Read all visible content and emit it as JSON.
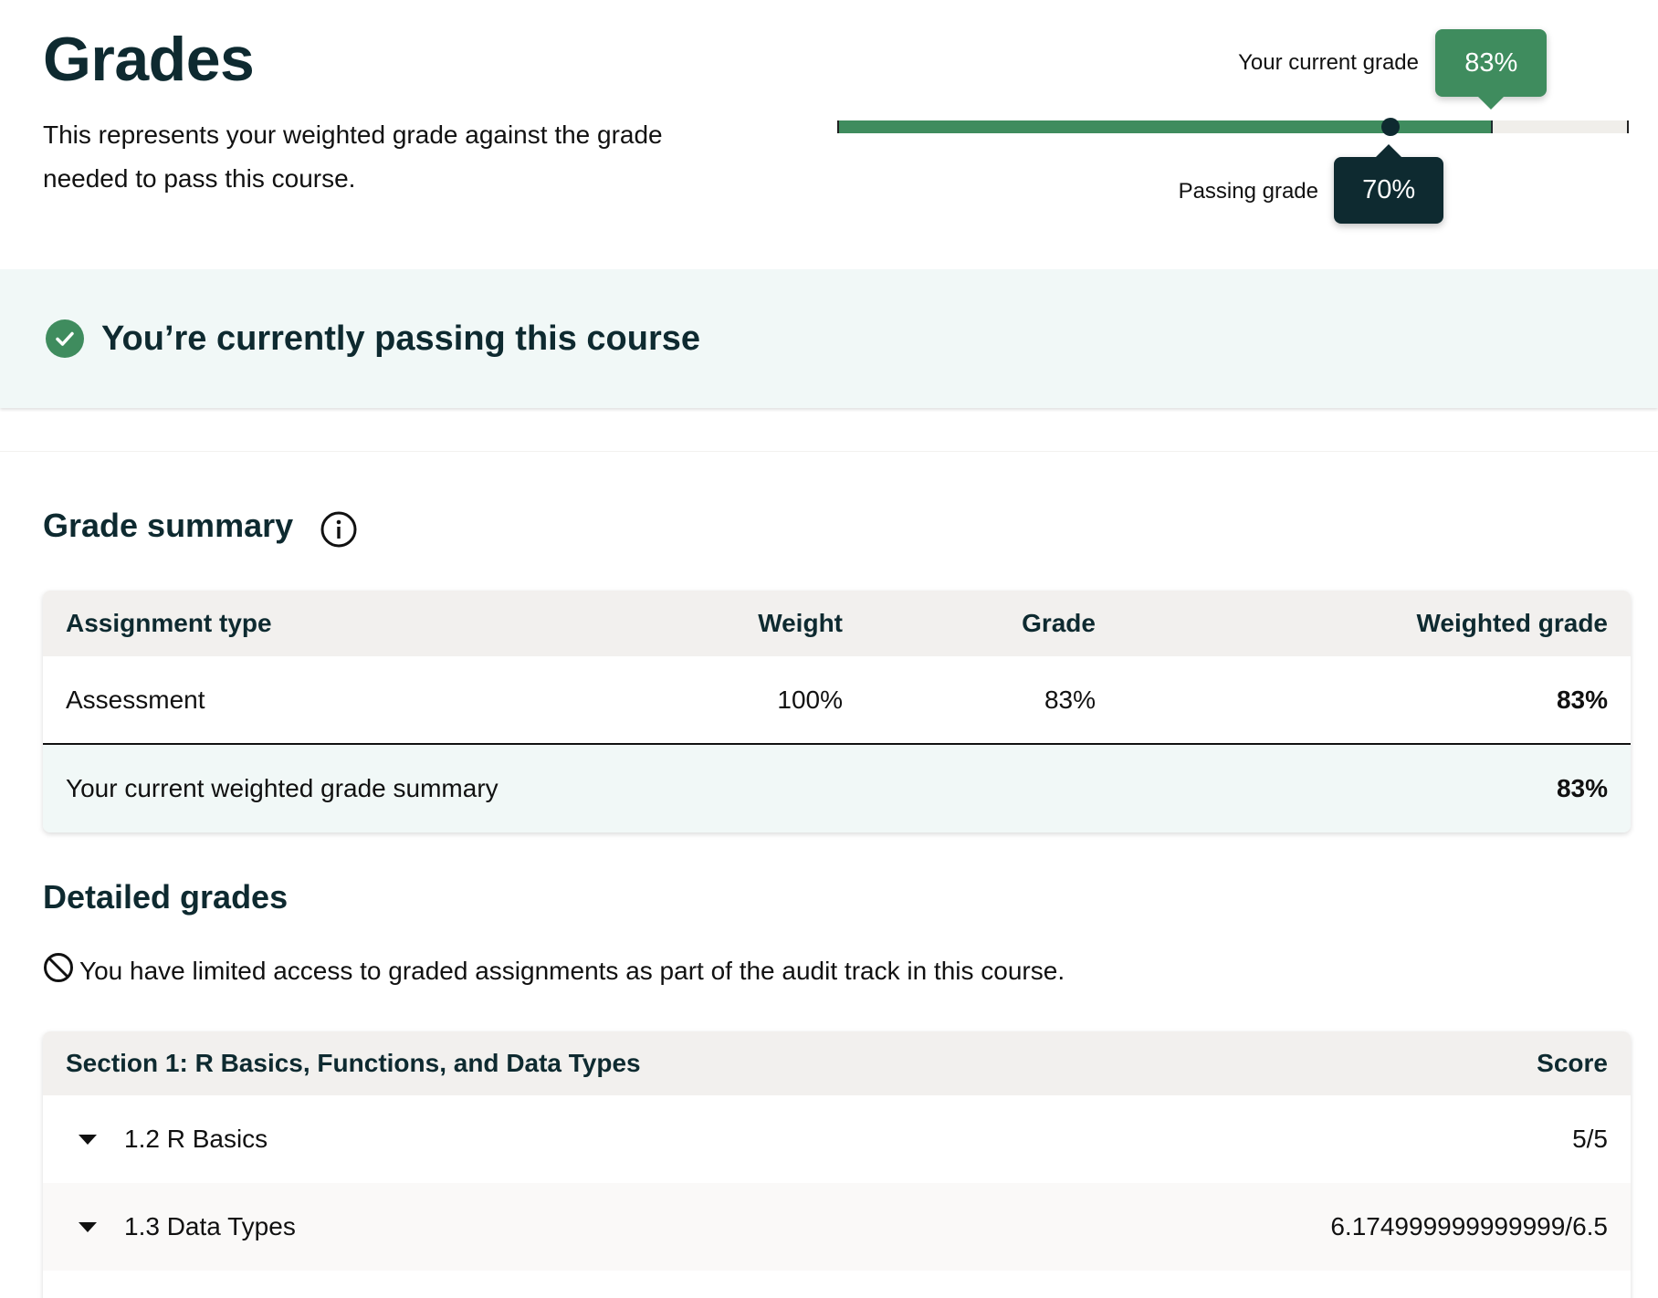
{
  "header": {
    "title": "Grades",
    "description": "This represents your weighted grade against the grade needed to pass this course."
  },
  "grade_bar": {
    "current_label": "Your current grade",
    "current_value": "83%",
    "current_fraction": 0.83,
    "passing_label": "Passing grade",
    "passing_value": "70%",
    "passing_fraction": 0.7,
    "fill_color": "#3f8c5e",
    "passing_color": "#0e2a30"
  },
  "banner": {
    "icon": "check-circle-icon",
    "text": "You’re currently passing this course",
    "color": "#3f8c5e"
  },
  "summary": {
    "title": "Grade summary",
    "info_icon": "info-icon",
    "columns": [
      "Assignment type",
      "Weight",
      "Grade",
      "Weighted grade"
    ],
    "rows": [
      {
        "type": "Assessment",
        "weight": "100%",
        "grade": "83%",
        "weighted": "83%"
      }
    ],
    "footer": {
      "label": "Your current weighted grade summary",
      "value": "83%"
    }
  },
  "detailed": {
    "title": "Detailed grades",
    "audit_icon": "block-icon",
    "audit_note": "You have limited access to graded assignments as part of the audit track in this course.",
    "section": {
      "title": "Section 1: R Basics, Functions, and Data Types",
      "score_header": "Score",
      "items": [
        {
          "label": "1.2 R Basics",
          "score": "5/5"
        },
        {
          "label": "1.3 Data Types",
          "score": "6.174999999999999/6.5"
        }
      ]
    }
  }
}
